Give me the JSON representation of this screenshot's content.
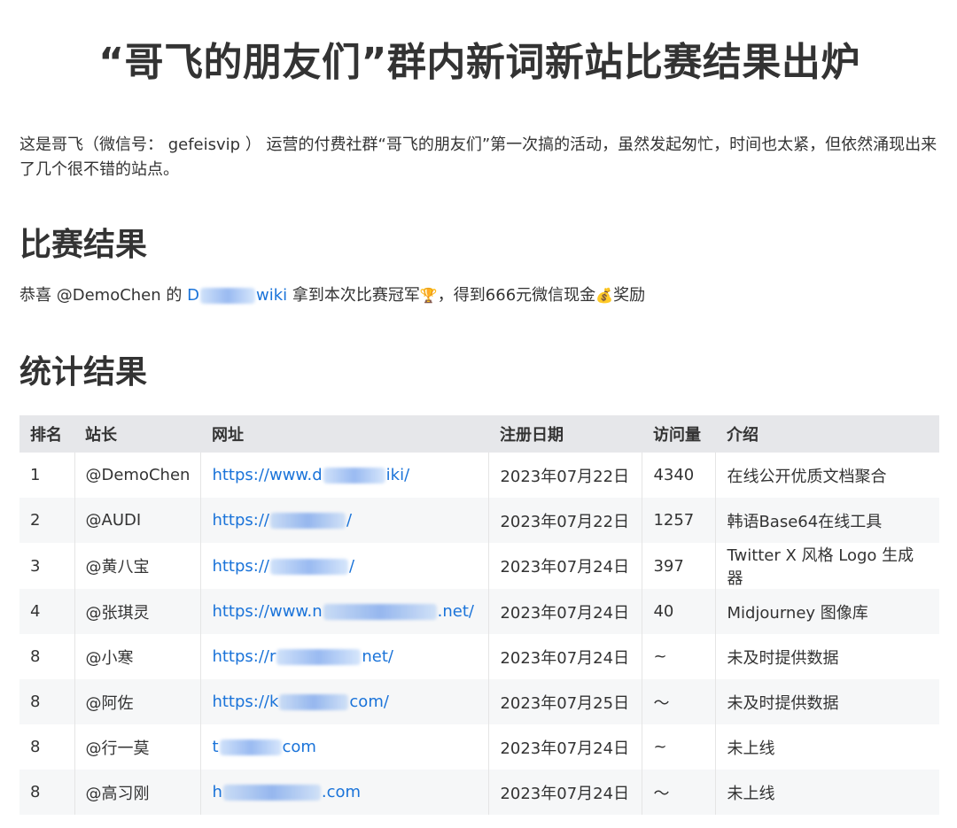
{
  "page": {
    "title": "“哥飞的朋友们”群内新词新站比赛结果出炉",
    "intro": "这是哥飞（微信号： gefeisvip ） 运营的付费社群“哥飞的朋友们”第一次搞的活动，虽然发起匆忙，时间也太紧，但依然涌现出来了几个很不错的站点。"
  },
  "result_section": {
    "heading": "比赛结果",
    "prefix": "恭喜 @DemoChen 的 ",
    "link_start": "D",
    "link_end": "wiki",
    "suffix_1": " 拿到本次比赛冠军",
    "trophy_emoji": "🏆",
    "suffix_2": "，得到666元微信现金",
    "money_emoji": "💰",
    "suffix_3": "奖励"
  },
  "stats_section": {
    "heading": "统计结果",
    "columns": [
      "排名",
      "站长",
      "网址",
      "注册日期",
      "访问量",
      "介绍"
    ],
    "rows": [
      {
        "rank": "1",
        "owner": "@DemoChen",
        "url_start": "https://www.d",
        "url_end": "iki/",
        "date": "2023年07月22日",
        "visits": "4340",
        "intro": "在线公开优质文档聚合"
      },
      {
        "rank": "2",
        "owner": "@AUDI",
        "url_start": "https://",
        "url_end": "/",
        "date": "2023年07月22日",
        "visits": "1257",
        "intro": "韩语Base64在线工具"
      },
      {
        "rank": "3",
        "owner": "@黄八宝",
        "url_start": "https://",
        "url_end": "/",
        "date": "2023年07月24日",
        "visits": "397",
        "intro": "Twitter X 风格 Logo 生成器"
      },
      {
        "rank": "4",
        "owner": "@张琪灵",
        "url_start": "https://www.n",
        "url_end": ".net/",
        "date": "2023年07月24日",
        "visits": "40",
        "intro": "Midjourney 图像库"
      },
      {
        "rank": "8",
        "owner": "@小寒",
        "url_start": "https://r",
        "url_end": "net/",
        "date": "2023年07月24日",
        "visits": "~",
        "intro": "未及时提供数据"
      },
      {
        "rank": "8",
        "owner": "@阿佐",
        "url_start": "https://k",
        "url_end": "com/",
        "date": "2023年07月25日",
        "visits": "～",
        "intro": "未及时提供数据"
      },
      {
        "rank": "8",
        "owner": "@行一莫",
        "url_start": "t",
        "url_end": "com",
        "date": "2023年07月24日",
        "visits": "~",
        "intro": "未上线"
      },
      {
        "rank": "8",
        "owner": "@高习刚",
        "url_start": "h",
        "url_end": ".com",
        "date": "2023年07月24日",
        "visits": "～",
        "intro": "未上线"
      }
    ]
  }
}
